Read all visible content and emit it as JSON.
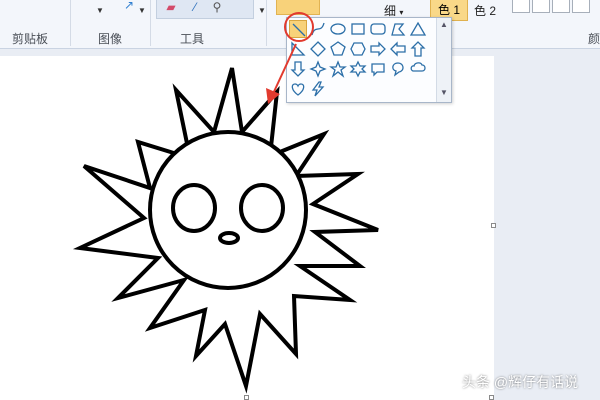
{
  "ribbon": {
    "groups": {
      "clipboard": "剪贴板",
      "image": "图像",
      "tools": "工具",
      "colors_partial": "颜"
    },
    "outline_label": "细",
    "color1_label": "色 1",
    "color2_label": "色 2"
  },
  "shapes_gallery": {
    "selected": "line",
    "rows": [
      [
        "line",
        "curve",
        "oval",
        "rectangle",
        "rounded-rectangle",
        "polygon",
        "triangle"
      ],
      [
        "right-triangle",
        "diamond",
        "pentagon",
        "hexagon",
        "right-arrow",
        "left-arrow",
        "up-arrow"
      ],
      [
        "down-arrow",
        "four-point-star",
        "five-point-star",
        "six-point-star",
        "rounded-callout",
        "oval-callout",
        "cloud-callout"
      ],
      [
        "heart",
        "lightning"
      ]
    ]
  },
  "accent": {
    "highlight_red": "#e23a2e",
    "selected_tool_fill": "#f8d27a"
  },
  "watermark": "头条 @辉仔有话说"
}
